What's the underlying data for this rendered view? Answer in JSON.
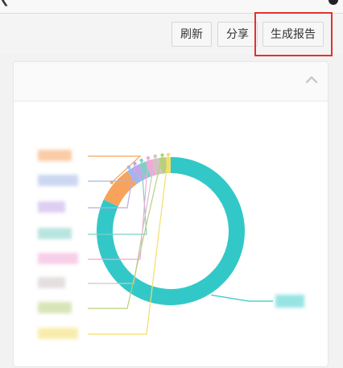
{
  "toolbar": {
    "refresh_label": "刷新",
    "share_label": "分享",
    "report_label": "生成报告"
  },
  "panel": {
    "title": ""
  },
  "icons": {
    "collapse": "chevron-up-icon"
  },
  "colors": {
    "highlight": "#e0332c",
    "ring_main": "#33c8c8",
    "orange": "#f4a460",
    "purple": "#b59ce0",
    "gray": "#c8c8c8"
  },
  "chart_data": {
    "type": "pie",
    "donut": true,
    "categories": [
      "",
      "",
      "",
      "",
      "",
      "",
      "",
      "",
      ""
    ],
    "values": [
      82,
      8,
      1.5,
      1.5,
      1.5,
      1.5,
      1.5,
      1.5,
      1
    ],
    "colors": [
      "#33c8c8",
      "#f7a35c",
      "#a3b6e8",
      "#c2a8e8",
      "#7fcfc6",
      "#f0a8d8",
      "#cfc5c5",
      "#b8cf7f",
      "#f4de6a"
    ],
    "title": "",
    "legend_position": "none"
  }
}
